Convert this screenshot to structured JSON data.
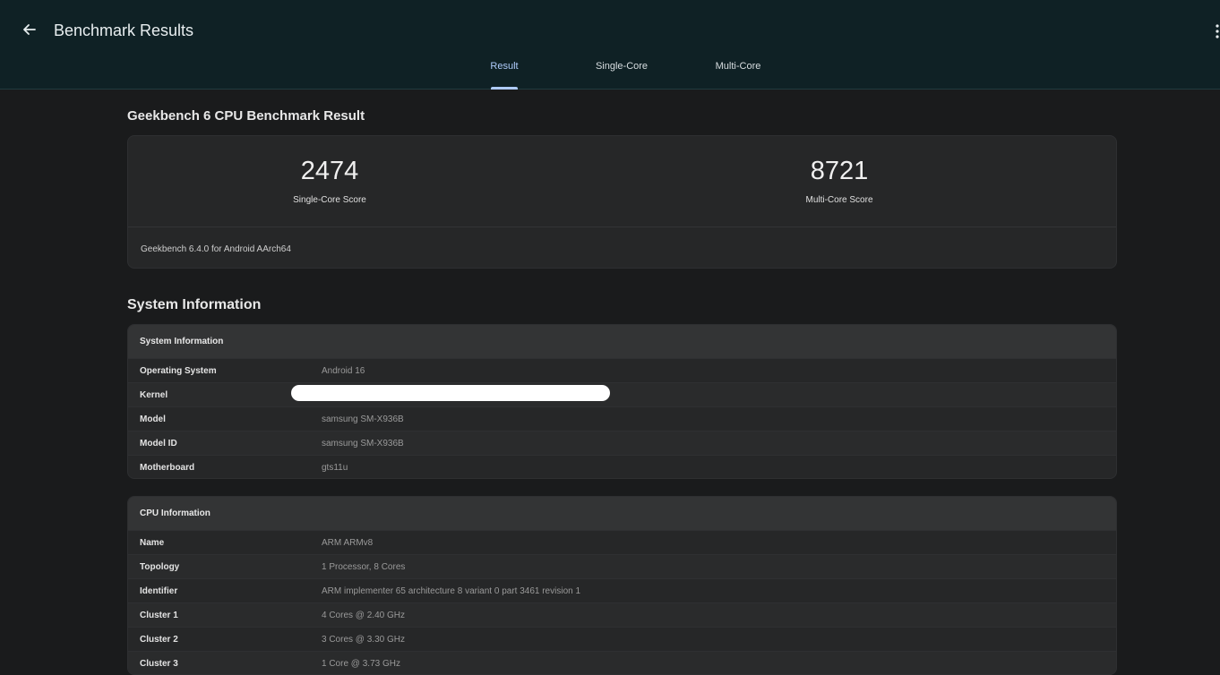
{
  "header": {
    "title": "Benchmark Results",
    "tabs": [
      {
        "label": "Result",
        "active": true
      },
      {
        "label": "Single-Core",
        "active": false
      },
      {
        "label": "Multi-Core",
        "active": false
      }
    ]
  },
  "result": {
    "title": "Geekbench 6 CPU Benchmark Result",
    "single_core_score": "2474",
    "single_core_label": "Single-Core Score",
    "multi_core_score": "8721",
    "multi_core_label": "Multi-Core Score",
    "version": "Geekbench 6.4.0 for Android AArch64"
  },
  "system_section_title": "System Information",
  "system_info": {
    "header": "System Information",
    "rows": [
      {
        "key": "Operating System",
        "value": "Android 16"
      },
      {
        "key": "Kernel",
        "value": ""
      },
      {
        "key": "Model",
        "value": "samsung SM-X936B"
      },
      {
        "key": "Model ID",
        "value": "samsung SM-X936B"
      },
      {
        "key": "Motherboard",
        "value": "gts11u"
      }
    ]
  },
  "cpu_info": {
    "header": "CPU Information",
    "rows": [
      {
        "key": "Name",
        "value": "ARM ARMv8"
      },
      {
        "key": "Topology",
        "value": "1 Processor, 8 Cores"
      },
      {
        "key": "Identifier",
        "value": "ARM implementer 65 architecture 8 variant 0 part 3461 revision 1"
      },
      {
        "key": "Cluster 1",
        "value": "4 Cores @ 2.40 GHz"
      },
      {
        "key": "Cluster 2",
        "value": "3 Cores @ 3.30 GHz"
      },
      {
        "key": "Cluster 3",
        "value": "1 Core @ 3.73 GHz"
      }
    ]
  },
  "colors": {
    "topbar": "#0f2125",
    "accent": "#aecbfa",
    "background": "#1a1b1c",
    "card": "#262728"
  },
  "icons": {
    "back": "arrow-left-icon",
    "overflow": "more-vert-icon"
  }
}
